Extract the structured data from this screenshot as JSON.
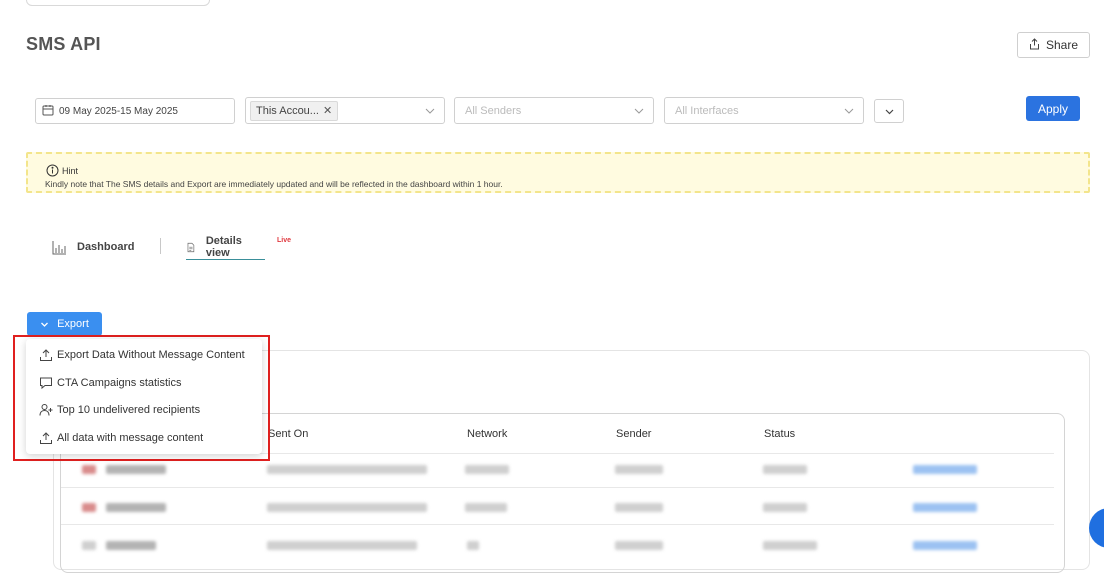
{
  "page": {
    "title": "SMS API"
  },
  "header": {
    "share_label": "Share"
  },
  "filters": {
    "date_range": "09 May 2025-15 May 2025",
    "account_tag": "This Accou...",
    "senders_placeholder": "All Senders",
    "interfaces_placeholder": "All Interfaces",
    "apply_label": "Apply"
  },
  "hint": {
    "title": "Hint",
    "text": "Kindly note that The SMS details and Export are immediately updated and will be reflected in the dashboard within 1 hour."
  },
  "tabs": [
    {
      "label": "Dashboard",
      "icon": "bar-chart-icon"
    },
    {
      "label": "Details view",
      "icon": "document-icon",
      "badge": "Live"
    }
  ],
  "export": {
    "label": "Export",
    "menu": [
      {
        "label": "Export Data Without Message Content",
        "icon": "upload-icon"
      },
      {
        "label": "CTA Campaigns statistics",
        "icon": "chat-icon"
      },
      {
        "label": "Top 10 undelivered recipients",
        "icon": "user-plus-icon"
      },
      {
        "label": "All data with message content",
        "icon": "upload-icon"
      }
    ]
  },
  "table": {
    "columns": [
      "Sent On",
      "Network",
      "Sender",
      "Status"
    ]
  },
  "colors": {
    "accent": "#2b73e0",
    "highlight": "#e0201f",
    "hint_bg": "#fffbe0",
    "live": "#e0383e"
  }
}
